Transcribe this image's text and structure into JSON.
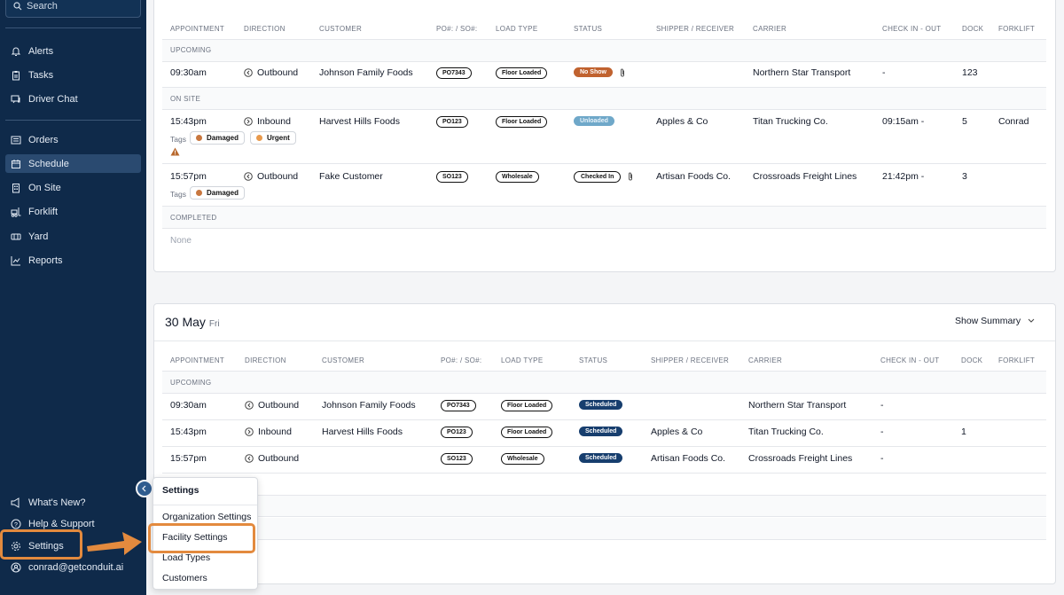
{
  "sidebar": {
    "search_label": "Search",
    "nav": [
      "Alerts",
      "Tasks",
      "Driver Chat",
      "Orders",
      "Schedule",
      "On Site",
      "Forklift",
      "Yard",
      "Reports"
    ],
    "bottom": [
      "What's New?",
      "Help & Support",
      "Settings",
      "conrad@getconduit.ai"
    ]
  },
  "table": {
    "headers": [
      "APPOINTMENT",
      "DIRECTION",
      "CUSTOMER",
      "PO#: / SO#:",
      "LOAD TYPE",
      "STATUS",
      "SHIPPER / RECEIVER",
      "CARRIER",
      "CHECK IN - OUT",
      "DOCK",
      "FORKLIFT"
    ],
    "tags_label": "Tags"
  },
  "day1": {
    "sections": [
      "UPCOMING",
      "ON SITE",
      "COMPLETED"
    ],
    "none_label": "None",
    "rows": [
      {
        "time": "09:30am",
        "direction": "Outbound",
        "customer": "Johnson Family Foods",
        "po": "PO7343",
        "load": "Floor Loaded",
        "status": "No Show",
        "shipper": "",
        "carrier": "Northern Star Transport",
        "check": "-",
        "dock": "123",
        "forklift": ""
      },
      {
        "time": "15:43pm",
        "direction": "Inbound",
        "customer": "Harvest Hills Foods",
        "po": "PO123",
        "load": "Floor Loaded",
        "status": "Unloaded",
        "shipper": "Apples & Co",
        "carrier": "Titan Trucking Co.",
        "check": "09:15am -",
        "dock": "5",
        "forklift": "Conrad",
        "tags": [
          "Damaged",
          "Urgent"
        ]
      },
      {
        "time": "15:57pm",
        "direction": "Outbound",
        "customer": "Fake Customer",
        "po": "SO123",
        "load": "Wholesale",
        "status": "Checked In",
        "shipper": "Artisan Foods Co.",
        "carrier": "Crossroads Freight Lines",
        "check": "21:42pm -",
        "dock": "3",
        "forklift": "",
        "tags": [
          "Damaged"
        ]
      }
    ]
  },
  "day2": {
    "date": "30 May",
    "weekday": "Fri",
    "summary_label": "Show Summary",
    "sections": [
      "UPCOMING"
    ],
    "rows": [
      {
        "time": "09:30am",
        "direction": "Outbound",
        "customer": "Johnson Family Foods",
        "po": "PO7343",
        "load": "Floor Loaded",
        "status": "Scheduled",
        "shipper": "",
        "carrier": "Northern Star Transport",
        "check": "-",
        "dock": ""
      },
      {
        "time": "15:43pm",
        "direction": "Inbound",
        "customer": "Harvest Hills Foods",
        "po": "PO123",
        "load": "Floor Loaded",
        "status": "Scheduled",
        "shipper": "Apples & Co",
        "carrier": "Titan Trucking Co.",
        "check": "-",
        "dock": "1"
      },
      {
        "time": "15:57pm",
        "direction": "Outbound",
        "customer": "",
        "po": "SO123",
        "load": "Wholesale",
        "status": "Scheduled",
        "shipper": "Artisan Foods Co.",
        "carrier": "Crossroads Freight Lines",
        "check": "-",
        "dock": ""
      }
    ]
  },
  "menu": {
    "title": "Settings",
    "items": [
      "Organization Settings",
      "Facility Settings",
      "Load Types",
      "Customers"
    ]
  },
  "colors": {
    "sidebar": "#0f2a4a",
    "highlight": "#e38a3e",
    "scheduled": "#173e6e",
    "no_show": "#c0622f",
    "tag_dot": "#c8773f"
  }
}
